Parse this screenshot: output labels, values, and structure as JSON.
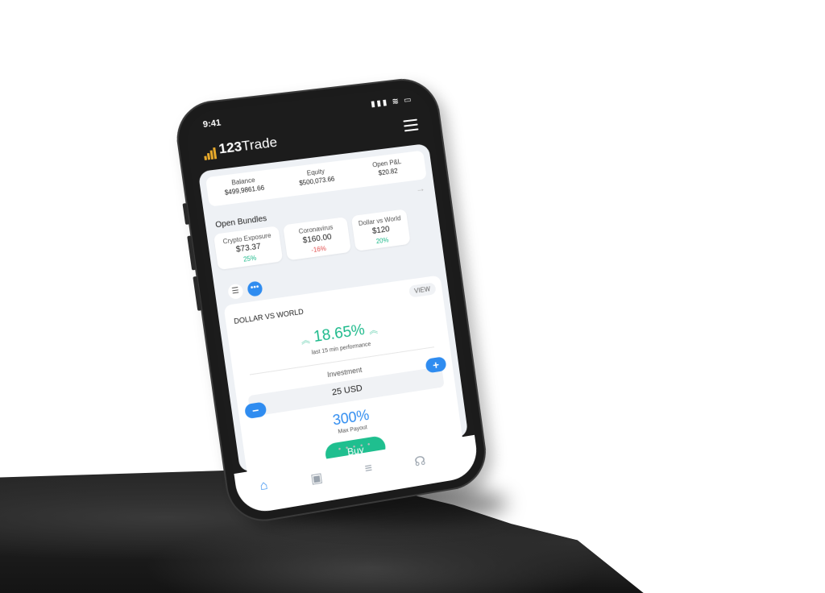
{
  "status": {
    "time": "9:41",
    "icons": "▮▮▮ ≋ ▭"
  },
  "app": {
    "name_bold": "123",
    "name_rest": "Trade",
    "brand_color": "#e7a92b",
    "accent": "#2f8cf0",
    "positive": "#1bb98a",
    "negative": "#e24c4c"
  },
  "summary": {
    "balance_label": "Balance",
    "balance_value": "$499,9861.66",
    "equity_label": "Equity",
    "equity_value": "$500,073.66",
    "pl_label": "Open P&L",
    "pl_value": "$20.82",
    "arrow": "→"
  },
  "bundles": {
    "title": "Open Bundles",
    "items": [
      {
        "name": "Crypto Exposure",
        "amount": "$73.37",
        "change": "25%",
        "dir": "pos"
      },
      {
        "name": "Coronavirus",
        "amount": "$160.00",
        "change": "-16%",
        "dir": "neg"
      },
      {
        "name": "Dollar vs World",
        "amount": "$120",
        "change": "20%",
        "dir": "pos"
      }
    ]
  },
  "toggles": {
    "list_icon": "☰",
    "dots_icon": "•••"
  },
  "card": {
    "title": "DOLLAR VS WORLD",
    "view": "VIEW",
    "performance": "18.65%",
    "performance_label": "last 15 min performance",
    "investment_label": "Investment",
    "investment_value": "25 USD",
    "minus": "−",
    "plus": "+",
    "payout": "300%",
    "payout_label": "Max Payout",
    "buy": "Buy",
    "pager": "● ● ● ● ●"
  },
  "tabs": [
    {
      "name": "home",
      "icon": "⌂"
    },
    {
      "name": "portfolio",
      "icon": "▣"
    },
    {
      "name": "wallet",
      "icon": "≡"
    },
    {
      "name": "support",
      "icon": "☊"
    }
  ]
}
